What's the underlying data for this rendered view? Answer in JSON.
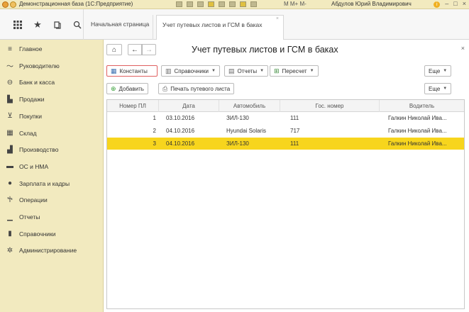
{
  "titlebar": {
    "title": "Демонстрационная база (1С:Предприятие)",
    "m_controls": "M M+ M-",
    "user": "Абдулов Юрий Владимирович",
    "info": "i",
    "minimize": "–",
    "restore": "□",
    "close": "×"
  },
  "nav": {
    "icons": [
      "apps-grid-icon",
      "star-icon",
      "history-icon",
      "search-icon"
    ],
    "tabs": [
      {
        "label": "Начальная страница"
      },
      {
        "label": "Учет путевых листов и ГСМ в баках"
      }
    ],
    "tab_close": "×"
  },
  "sidebar": {
    "items": [
      {
        "label": "Главное",
        "icon": "menu-icon",
        "glyph": "≡"
      },
      {
        "label": "Руководителю",
        "icon": "chart-line-icon",
        "glyph": "〜"
      },
      {
        "label": "Банк и касса",
        "icon": "bank-icon",
        "glyph": "⊖"
      },
      {
        "label": "Продажи",
        "icon": "sales-icon",
        "glyph": "▙"
      },
      {
        "label": "Покупки",
        "icon": "cart-icon",
        "glyph": "⊻"
      },
      {
        "label": "Склад",
        "icon": "warehouse-icon",
        "glyph": "▦"
      },
      {
        "label": "Производство",
        "icon": "factory-icon",
        "glyph": "▟"
      },
      {
        "label": "ОС и НМА",
        "icon": "truck-icon",
        "glyph": "▬"
      },
      {
        "label": "Зарплата и кадры",
        "icon": "person-icon",
        "glyph": "●"
      },
      {
        "label": "Операции",
        "icon": "operations-icon",
        "glyph": "Ⴕ"
      },
      {
        "label": "Отчеты",
        "icon": "bar-chart-icon",
        "glyph": "▁"
      },
      {
        "label": "Справочники",
        "icon": "book-icon",
        "glyph": "▮"
      },
      {
        "label": "Администрирование",
        "icon": "gear-icon",
        "glyph": "✲"
      }
    ]
  },
  "form": {
    "title": "Учет путевых листов и ГСМ в баках",
    "home_glyph": "⌂",
    "back_glyph": "←",
    "forward_glyph": "→",
    "close_glyph": "×",
    "toolbar1": {
      "constants": "Константы",
      "references": "Справочники",
      "reports": "Отчеты",
      "recalc": "Пересчет",
      "more": "Еще"
    },
    "toolbar2": {
      "add": "Добавить",
      "print": "Печать путевого листа",
      "more": "Еще"
    },
    "table": {
      "columns": [
        "Номер ПЛ",
        "Дата",
        "Автомобиль",
        "Гос. номер",
        "Водитель"
      ],
      "rows": [
        {
          "num": "1",
          "date": "03.10.2016",
          "car": "ЗИЛ-130",
          "plate": "111",
          "driver": "Галкин Николай Ива..."
        },
        {
          "num": "2",
          "date": "04.10.2016",
          "car": "Hyundai Solaris",
          "plate": "717",
          "driver": "Галкин Николай Ива..."
        },
        {
          "num": "3",
          "date": "04.10.2016",
          "car": "ЗИЛ-130",
          "plate": "111",
          "driver": "Галкин Николай Ива..."
        }
      ],
      "selected_row": 2
    }
  },
  "colors": {
    "sidebar_bg": "#f2eabf",
    "selection": "#f7d51d",
    "accent_red": "#e06060"
  }
}
